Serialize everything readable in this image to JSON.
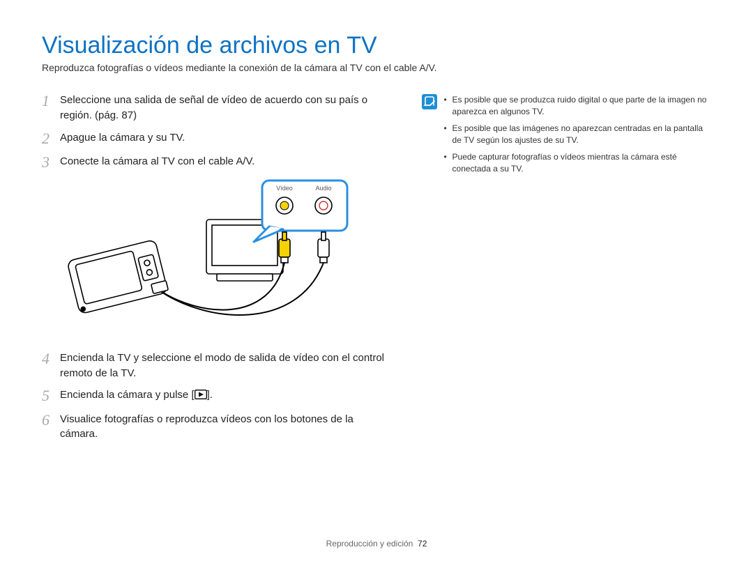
{
  "title": "Visualización de archivos en TV",
  "subtitle": "Reproduzca fotografías o vídeos mediante la conexión de la cámara al TV con el cable A/V.",
  "steps": [
    {
      "num": "1",
      "text": "Seleccione una salida de señal de vídeo de acuerdo con su país o región. (pág. 87)"
    },
    {
      "num": "2",
      "text": "Apague la cámara y su TV."
    },
    {
      "num": "3",
      "text": "Conecte la cámara al TV con el cable A/V."
    },
    {
      "num": "4",
      "text": "Encienda la TV y seleccione el modo de salida de vídeo con el control remoto de la TV."
    },
    {
      "num": "5",
      "text_pre": "Encienda la cámara y pulse [",
      "text_post": "]."
    },
    {
      "num": "6",
      "text": "Visualice fotografías o reproduzca vídeos con los botones de la cámara."
    }
  ],
  "illustration": {
    "video_label": "Vídeo",
    "audio_label": "Audio"
  },
  "notes": [
    "Es posible que se produzca ruido digital o que parte de la imagen no aparezca en algunos TV.",
    "Es posible que las imágenes no aparezcan centradas en la pantalla de TV según los ajustes de su TV.",
    "Puede capturar fotografías o vídeos mientras la cámara esté conectada a su TV."
  ],
  "footer": {
    "section": "Reproducción y edición",
    "page": "72"
  },
  "colors": {
    "accent": "#0d72c4",
    "step_num": "#a7a9ac",
    "note_bg": "#1d8fd8",
    "callout_border": "#2b8fe0",
    "rca_video": "#f6d200",
    "rca_audio": "#ffffff"
  }
}
